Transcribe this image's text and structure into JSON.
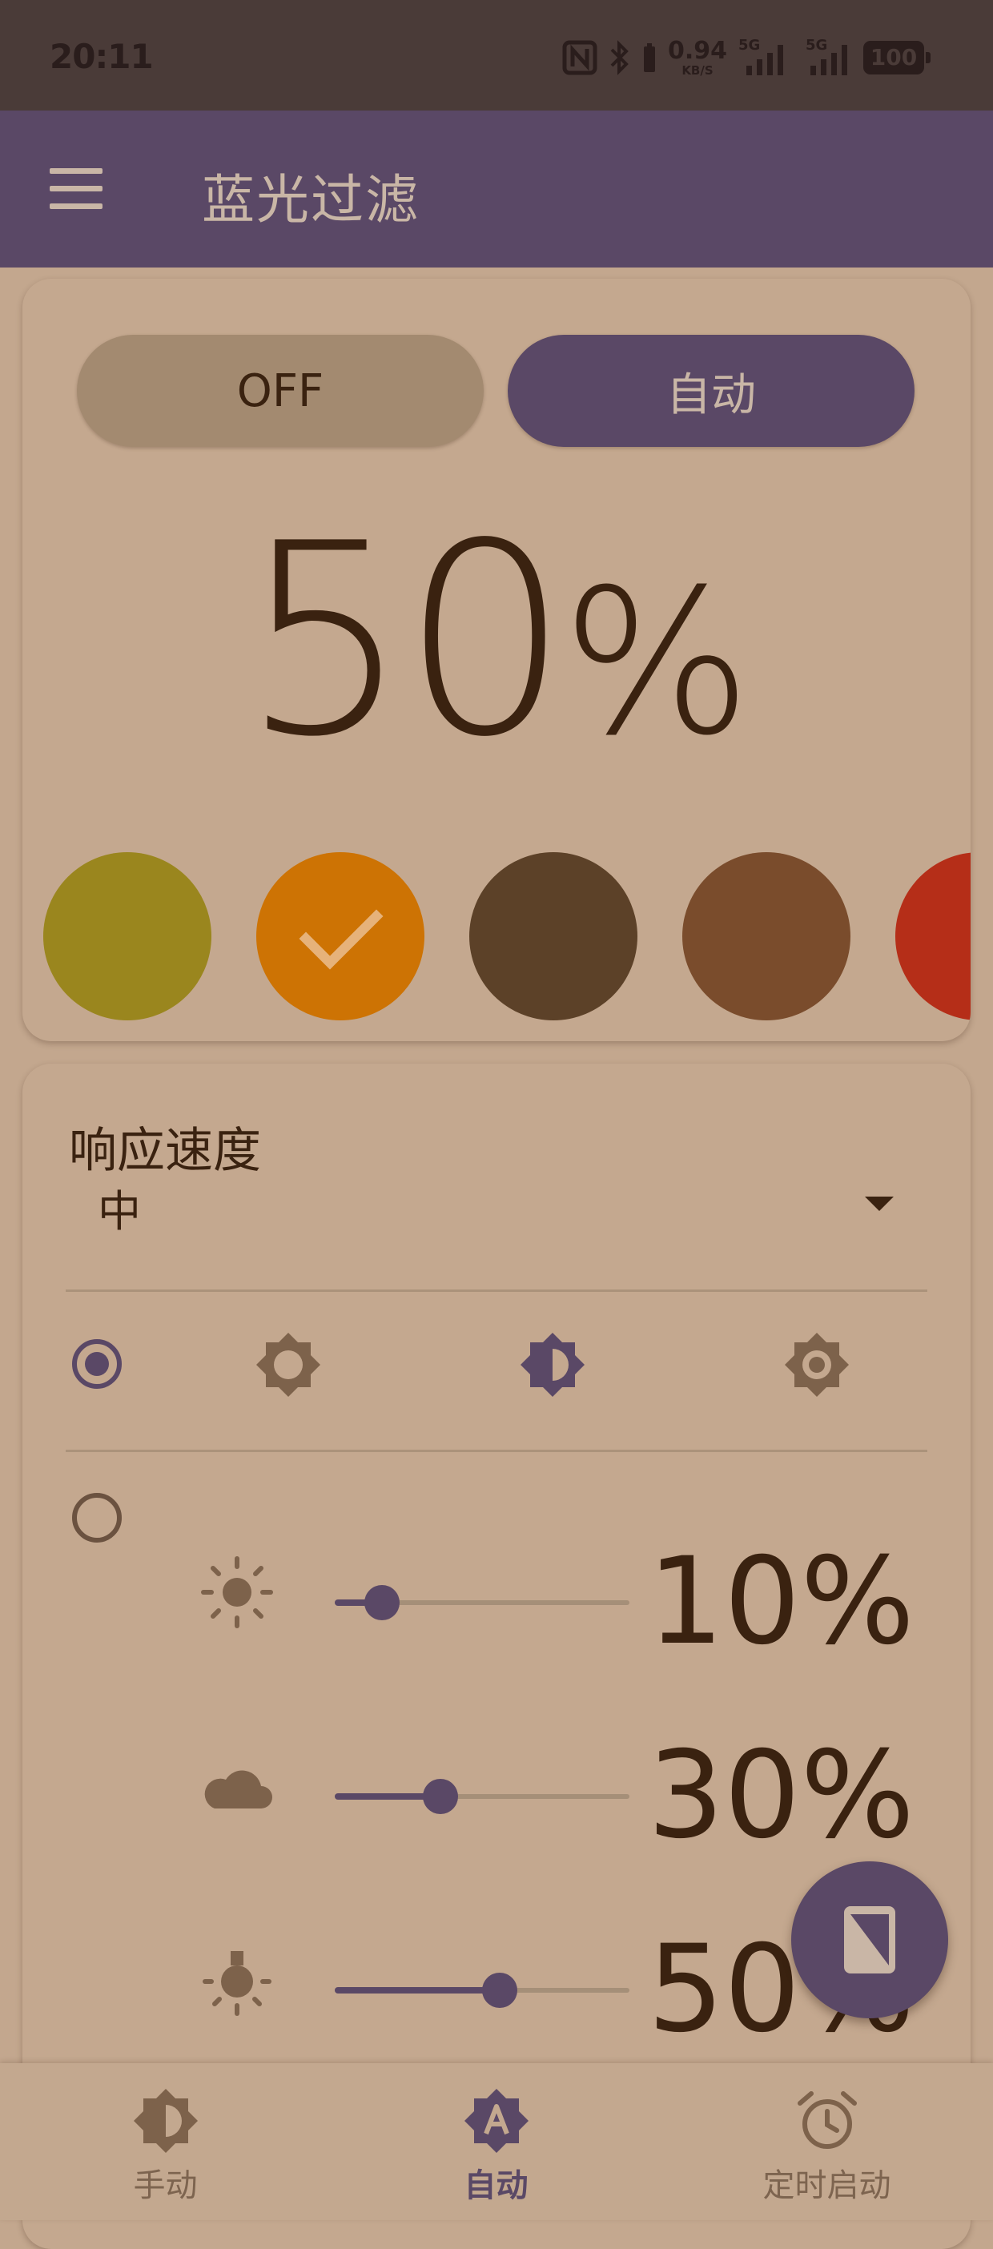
{
  "status_bar": {
    "time": "20:11",
    "net_speed": "0.94",
    "net_unit": "KB/S",
    "sim1": "5G",
    "sim2": "5G",
    "battery": "100",
    "icons": [
      "nfc-icon",
      "bluetooth-icon",
      "signal-icon",
      "battery-icon"
    ]
  },
  "app_bar": {
    "title": "蓝光过滤",
    "menu_icon": "hamburger-menu-icon"
  },
  "mode_toggle": {
    "off_label": "OFF",
    "auto_label": "自动",
    "selected": "自动"
  },
  "filter": {
    "percent_value": "50",
    "percent_sign": "%",
    "swatches": [
      {
        "color": "#9a861e",
        "selected": false
      },
      {
        "color": "#cd7304",
        "selected": true
      },
      {
        "color": "#5c4128",
        "selected": false
      },
      {
        "color": "#7a4c2c",
        "selected": false
      },
      {
        "color": "#b52e18",
        "selected": false
      }
    ]
  },
  "response": {
    "label": "响应速度",
    "value": "中"
  },
  "modes": {
    "icons": [
      "brightness-low-icon",
      "brightness-half-icon",
      "brightness-auto-icon"
    ],
    "selected": "radio-1"
  },
  "levels": [
    {
      "icon": "sun-icon",
      "value": 0.1,
      "label": "10%"
    },
    {
      "icon": "cloud-icon",
      "value": 0.3,
      "label": "30%"
    },
    {
      "icon": "lamp-icon",
      "value": 0.5,
      "label": "50%"
    }
  ],
  "fab": {
    "icon": "screen-filter-icon"
  },
  "bottom_nav": {
    "items": [
      {
        "label": "手动",
        "icon": "contrast-icon"
      },
      {
        "label": "自动",
        "icon": "auto-brightness-icon"
      },
      {
        "label": "定时启动",
        "icon": "alarm-clock-icon"
      }
    ],
    "active": "自动"
  },
  "colors": {
    "primary": "#5a4866",
    "background": "#c3a78e",
    "text": "#3a2210",
    "status_bar": "#4a3b38"
  }
}
